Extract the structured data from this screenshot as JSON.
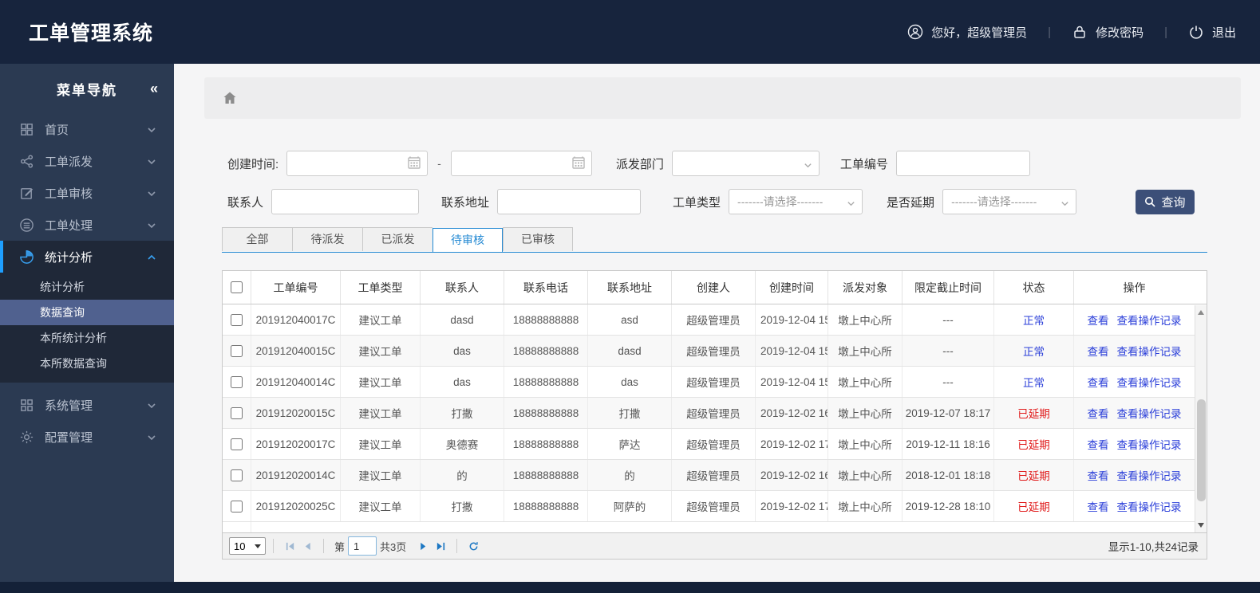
{
  "header": {
    "title": "工单管理系统",
    "greeting": "您好，超级管理员",
    "change_password": "修改密码",
    "logout": "退出",
    "separator": "|"
  },
  "sidebar": {
    "nav_title": "菜单导航",
    "collapse_glyph": "«",
    "items": [
      {
        "label": "首页",
        "icon": "home-grid-icon"
      },
      {
        "label": "工单派发",
        "icon": "share-icon"
      },
      {
        "label": "工单审核",
        "icon": "edit-icon"
      },
      {
        "label": "工单处理",
        "icon": "process-icon"
      },
      {
        "label": "统计分析",
        "icon": "pie-chart-icon",
        "expanded": true,
        "children": [
          {
            "label": "统计分析"
          },
          {
            "label": "数据查询",
            "selected": true
          },
          {
            "label": "本所统计分析"
          },
          {
            "label": "本所数据查询"
          }
        ]
      },
      {
        "label": "系统管理",
        "icon": "modules-icon"
      },
      {
        "label": "配置管理",
        "icon": "gear-icon"
      }
    ]
  },
  "filters": {
    "created_time_label": "创建时间:",
    "range_separator": "-",
    "department_label": "派发部门",
    "order_id_label": "工单编号",
    "contact_label": "联系人",
    "address_label": "联系地址",
    "order_type_label": "工单类型",
    "delay_label": "是否延期",
    "select_placeholder": "-------请选择-------",
    "search_button": "查询"
  },
  "tabs": {
    "items": [
      "全部",
      "待派发",
      "已派发",
      "待审核",
      "已审核"
    ],
    "active_index": 3
  },
  "table": {
    "headers": [
      "工单编号",
      "工单类型",
      "联系人",
      "联系电话",
      "联系地址",
      "创建人",
      "创建时间",
      "派发对象",
      "限定截止时间",
      "状态",
      "操作"
    ],
    "action_labels": [
      "查看",
      "查看操作记录"
    ],
    "status_colors": {
      "normal": "#2b3fd9",
      "delayed": "#e01a1a"
    },
    "rows": [
      {
        "id": "201912040017C",
        "type": "建议工单",
        "contact": "dasd",
        "phone": "18888888888",
        "address": "asd",
        "creator": "超级管理员",
        "created": "2019-12-04 15",
        "dispatch_target": "墩上中心所",
        "deadline": "---",
        "status": "正常",
        "status_color": "#2b3fd9"
      },
      {
        "id": "201912040015C",
        "type": "建议工单",
        "contact": "das",
        "phone": "18888888888",
        "address": "dasd",
        "creator": "超级管理员",
        "created": "2019-12-04 15",
        "dispatch_target": "墩上中心所",
        "deadline": "---",
        "status": "正常",
        "status_color": "#2b3fd9"
      },
      {
        "id": "201912040014C",
        "type": "建议工单",
        "contact": "das",
        "phone": "18888888888",
        "address": "das",
        "creator": "超级管理员",
        "created": "2019-12-04 15",
        "dispatch_target": "墩上中心所",
        "deadline": "---",
        "status": "正常",
        "status_color": "#2b3fd9"
      },
      {
        "id": "201912020015C",
        "type": "建议工单",
        "contact": "打撒",
        "phone": "18888888888",
        "address": "打撒",
        "creator": "超级管理员",
        "created": "2019-12-02 16",
        "dispatch_target": "墩上中心所",
        "deadline": "2019-12-07 18:17",
        "status": "已延期",
        "status_color": "#e01a1a"
      },
      {
        "id": "201912020017C",
        "type": "建议工单",
        "contact": "奥德赛",
        "phone": "18888888888",
        "address": "萨达",
        "creator": "超级管理员",
        "created": "2019-12-02 17",
        "dispatch_target": "墩上中心所",
        "deadline": "2019-12-11 18:16",
        "status": "已延期",
        "status_color": "#e01a1a"
      },
      {
        "id": "201912020014C",
        "type": "建议工单",
        "contact": "的",
        "phone": "18888888888",
        "address": "的",
        "creator": "超级管理员",
        "created": "2019-12-02 16",
        "dispatch_target": "墩上中心所",
        "deadline": "2018-12-01 18:18",
        "status": "已延期",
        "status_color": "#e01a1a"
      },
      {
        "id": "201912020025C",
        "type": "建议工单",
        "contact": "打撒",
        "phone": "18888888888",
        "address": "阿萨的",
        "creator": "超级管理员",
        "created": "2019-12-02 17",
        "dispatch_target": "墩上中心所",
        "deadline": "2019-12-28 18:10",
        "status": "已延期",
        "status_color": "#e01a1a"
      }
    ]
  },
  "pagination": {
    "page_size": "10",
    "page_prefix": "第",
    "current_page": "1",
    "total_pages_text": "共3页",
    "summary": "显示1-10,共24记录"
  },
  "colors": {
    "header_bg": "#17243d",
    "sidebar_bg": "#2b3a52",
    "submenu_selected_bg": "#50618f",
    "active_accent": "#1e9fff",
    "tab_active": "#2389d3",
    "link_blue": "#2b3fd9",
    "status_red": "#e01a1a",
    "search_button_bg": "#3c4f78"
  }
}
